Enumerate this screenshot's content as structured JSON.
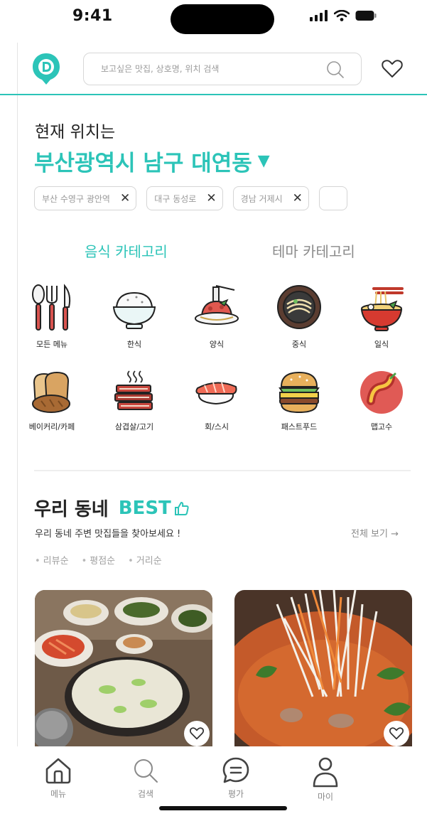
{
  "status": {
    "time": "9:41"
  },
  "header": {
    "search_placeholder": "보고싶은 맛집, 상호명, 위치 검색",
    "brand_color": "#2cc4b8"
  },
  "location": {
    "label": "현재 위치는",
    "value": "부산광역시 남구 대연동",
    "caret": "▼"
  },
  "recent_locations": [
    {
      "label": "부산 수영구 광안역"
    },
    {
      "label": "대구 동성로"
    },
    {
      "label": "경남 거제시"
    }
  ],
  "tabs": [
    {
      "label": "음식 카테고리",
      "active": true
    },
    {
      "label": "테마 카테고리",
      "active": false
    }
  ],
  "categories": [
    {
      "label": "모든 메뉴",
      "icon": "cutlery-icon"
    },
    {
      "label": "한식",
      "icon": "rice-bowl-icon"
    },
    {
      "label": "양식",
      "icon": "pasta-icon"
    },
    {
      "label": "중식",
      "icon": "jjajang-bowl-icon"
    },
    {
      "label": "일식",
      "icon": "ramen-bowl-icon"
    },
    {
      "label": "베이커리/카페",
      "icon": "bread-icon"
    },
    {
      "label": "삼겹살/고기",
      "icon": "pork-belly-icon"
    },
    {
      "label": "회/스시",
      "icon": "sushi-icon"
    },
    {
      "label": "패스트푸드",
      "icon": "burger-icon"
    },
    {
      "label": "맵고수",
      "icon": "chili-icon"
    }
  ],
  "best": {
    "title": "우리 동네",
    "accent": "BEST",
    "subtitle": "우리 동네 주변 맛집들을 찾아보세요 !",
    "see_all": "전체 보기 →",
    "sorts": [
      "리뷰순",
      "평점순",
      "거리순"
    ]
  },
  "bottom_nav": [
    {
      "label": "메뉴",
      "icon": "home-icon"
    },
    {
      "label": "검색",
      "icon": "search-icon"
    },
    {
      "label": "평가",
      "icon": "chat-bubble-icon"
    },
    {
      "label": "마이",
      "icon": "person-icon"
    }
  ]
}
